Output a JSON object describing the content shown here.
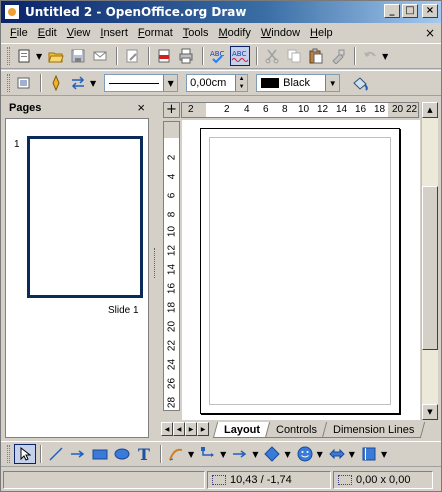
{
  "window": {
    "title": "Untitled 2 - OpenOffice.org Draw",
    "minimize": "_",
    "maximize": "□",
    "close": "×"
  },
  "menu": {
    "items": [
      "File",
      "Edit",
      "View",
      "Insert",
      "Format",
      "Tools",
      "Modify",
      "Window",
      "Help"
    ],
    "close": "×"
  },
  "toolbar_standard": {
    "icons": [
      "new-icon",
      "open-icon",
      "save-icon",
      "email-icon",
      "edit-file-icon",
      "export-pdf-icon",
      "print-icon",
      "spellcheck-icon",
      "autospellcheck-icon",
      "cut-icon",
      "copy-icon",
      "paste-icon",
      "clone-format-icon",
      "undo-icon"
    ]
  },
  "toolbar_line": {
    "line_width": "0,00cm",
    "area_color": "Black",
    "area_color_hex": "#000000"
  },
  "pages_pane": {
    "title": "Pages",
    "close": "×",
    "slides": [
      {
        "number": "1",
        "label": "Slide 1"
      }
    ]
  },
  "hruler": {
    "ticks": [
      "2",
      "2",
      "4",
      "6",
      "8",
      "10",
      "12",
      "14",
      "16",
      "18",
      "20",
      "22"
    ]
  },
  "vruler": {
    "ticks": [
      "2",
      "4",
      "6",
      "8",
      "10",
      "12",
      "14",
      "16",
      "18",
      "20",
      "22",
      "24",
      "26",
      "28"
    ]
  },
  "tabs": {
    "items": [
      {
        "label": "Layout",
        "active": true
      },
      {
        "label": "Controls",
        "active": false
      },
      {
        "label": "Dimension Lines",
        "active": false
      }
    ]
  },
  "drawbar": {
    "text_tool": "T"
  },
  "status": {
    "position": "10,43 / -1,74",
    "size": "0,00 x 0,00"
  }
}
